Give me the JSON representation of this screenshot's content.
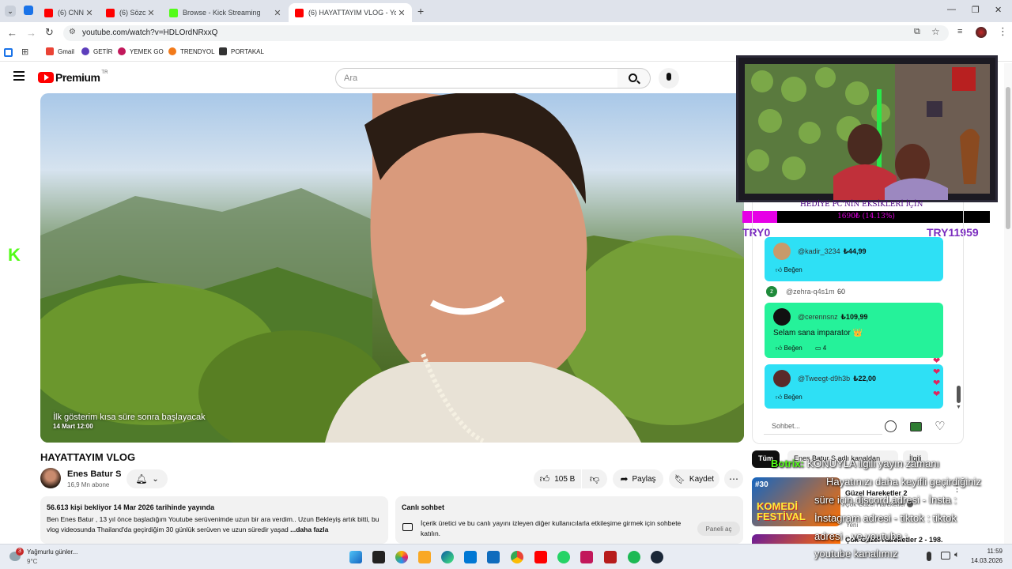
{
  "browser": {
    "tabs": [
      {
        "label": "(6) CNN T",
        "color": "#ff0000"
      },
      {
        "label": "(6) Sözcü",
        "color": "#ff0000"
      },
      {
        "label": "Browse - Kick Streaming",
        "color": "#53fc18"
      },
      {
        "label": "(6) HAYATTAYIM VLOG - YouTube",
        "color": "#ff0000"
      }
    ],
    "url": "youtube.com/watch?v=HDLOrdNRxxQ",
    "bookmarks": [
      "Gmail",
      "GETİR",
      "YEMEK GO",
      "TRENDYOL",
      "PORTAKAL"
    ]
  },
  "youtube": {
    "logo_text": "Premium",
    "logo_region": "TR",
    "search_placeholder": "Ara",
    "video": {
      "premiere_notice": "İlk gösterim kısa süre sonra başlayacak",
      "premiere_time": "14 Mart 12:00"
    },
    "title": "HAYATTAYIM VLOG",
    "channel": {
      "name": "Enes Batur S",
      "subscribers": "16,9 Mn abone"
    },
    "actions": {
      "likes": "105 B",
      "share": "Paylaş",
      "save": "Kaydet"
    },
    "description": {
      "stats": "56.613 kişi bekliyor  14 Mar 2026 tarihinde yayında",
      "text": "Ben Enes Batur , 13 yıl önce başladığım Youtube serüvenimde uzun bir ara verdim.. Uzun Bekleyiş artık bitti, bu vlog videosunda Thailand'da geçirdiğim 30 günlük serüven ve uzun süredir yaşad",
      "more": "...daha fazla"
    },
    "live_chat_box": {
      "title": "Canlı sohbet",
      "text": "İçerik üretici ve bu canlı yayını izleyen diğer kullanıcılarla etkileşime girmek için sohbete katılın.",
      "button": "Paneli aç"
    }
  },
  "overlay": {
    "goal_text": "HEDİYE PC'NİN EKSİKLERİ İÇİN",
    "goal_progress_text": "1690₺ (14.13%)",
    "goal_fraction": 0.1413,
    "left_label": "TRY0",
    "right_label": "TRY11959"
  },
  "chat": {
    "messages": [
      {
        "user": "@kadir_3234",
        "amount": "₺44,99",
        "text": "",
        "like": "Beğen",
        "color": "#2ee0f5",
        "avatar": "#c89a6a"
      },
      {
        "user": "@cerennsnz",
        "amount": "₺109,99",
        "text": "Selam sana imparator 👑",
        "like": "Beğen",
        "replies": "4",
        "color": "#25f29a",
        "avatar": "#111111"
      },
      {
        "user": "@Tweegt-d9h3b",
        "amount": "₺22,00",
        "text": "",
        "like": "Beğen",
        "color": "#2ee0f5",
        "avatar": "#5a2a2a"
      }
    ],
    "plain_message": {
      "user": "@zehra-q4s1m",
      "text": "60",
      "initial": "z"
    },
    "input_placeholder": "Sohbet..."
  },
  "suggestions": {
    "chips": [
      "Tüm",
      "Enes Batur S adlı kanaldan",
      "İlgili"
    ],
    "items": [
      {
        "title": "Güzel Hareketler 2",
        "channel": "Çok Güzel Hareketler",
        "meta": "Yeni",
        "thumb_text": "KOMEDİ FESTİVAL",
        "duration": "#30"
      },
      {
        "title": "Çok Güzel Hareketler 2 - 198.",
        "channel": "",
        "meta": "",
        "thumb_text": "",
        "duration": ""
      }
    ]
  },
  "stream_overlay_text": {
    "kick_logo": "K",
    "bot_name": "Botrix:",
    "lines": [
      "KONUYLA ilgili yayın zamanı",
      "Hayatınızı daha keyifli geçirdiğiniz",
      "süre için discord adresi - İnsta :",
      "İnstagram adresi - tiktok : tiktok",
      "adresi - ve youtube :",
      "youtube kanalımız"
    ]
  },
  "taskbar": {
    "weather_title": "Yağmurlu günler...",
    "weather_temp": "9°C",
    "notification_count": "3",
    "time": "11:59",
    "date": "14.03.2026"
  }
}
